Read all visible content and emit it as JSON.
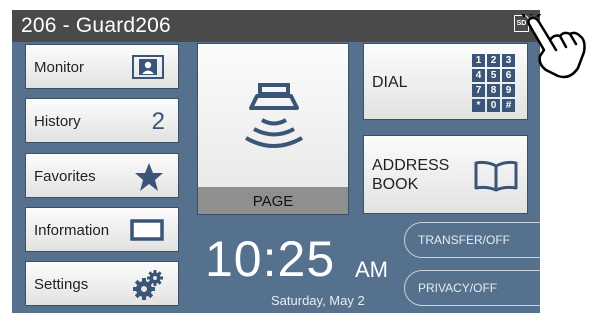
{
  "header": {
    "title": "206 - Guard206",
    "sd_icon_label": "SD"
  },
  "sidebar": {
    "monitor_label": "Monitor",
    "history_label": "History",
    "history_count": "2",
    "favorites_label": "Favorites",
    "information_label": "Information",
    "settings_label": "Settings"
  },
  "page_button": {
    "label": "PAGE"
  },
  "dial_button": {
    "label": "DIAL",
    "keypad": [
      "1",
      "2",
      "3",
      "4",
      "5",
      "6",
      "7",
      "8",
      "9",
      "*",
      "0",
      "#"
    ]
  },
  "address_book_button": {
    "line1": "ADDRESS",
    "line2": "BOOK"
  },
  "clock": {
    "time": "10:25",
    "ampm": "AM",
    "date": "Saturday, May 2"
  },
  "toggles": {
    "transfer_label": "TRANSFER/OFF",
    "privacy_label": "PRIVACY/OFF"
  },
  "colors": {
    "screen_bg": "#56718d",
    "title_bar": "#4a4a4a",
    "icon_blue": "#3a5577",
    "page_caption_bg": "#8f8f8f"
  }
}
